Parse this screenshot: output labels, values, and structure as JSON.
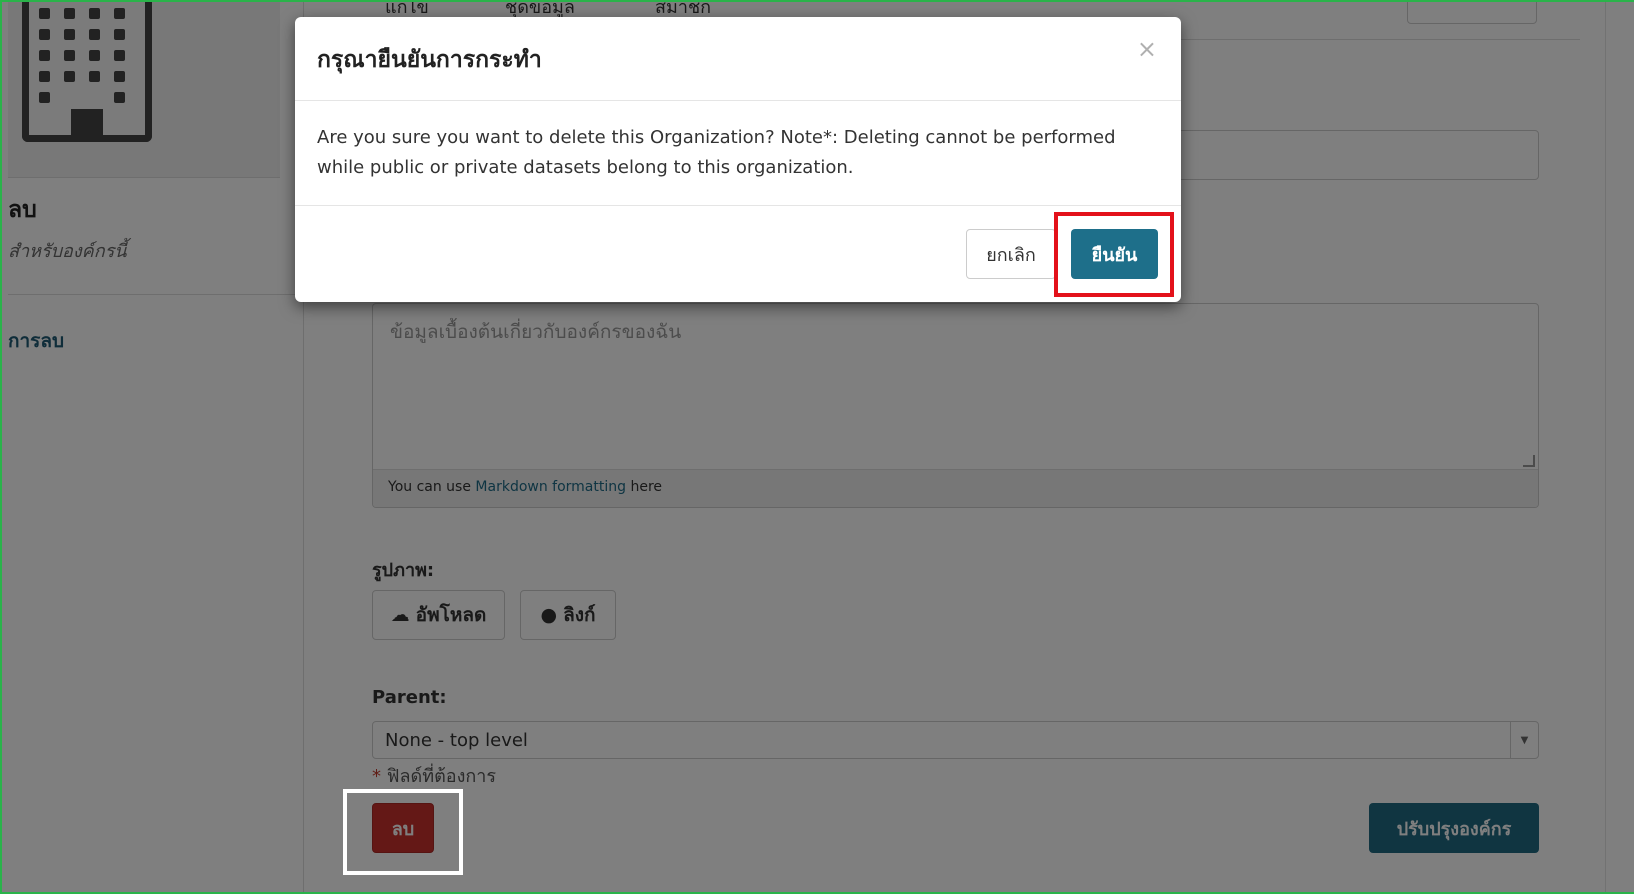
{
  "top_tabs": [
    "แก้ไข",
    "ชุดข้อมูล",
    "สมาชิก"
  ],
  "sidebar": {
    "title": "ลบ",
    "description": "สำหรับองค์กรนี้",
    "link_label": "การลบ"
  },
  "form": {
    "description_placeholder": "ข้อมูลเบื้องต้นเกี่ยวกับองค์กรของฉัน",
    "markdown_hint_prefix": "You can use ",
    "markdown_hint_link": "Markdown formatting",
    "markdown_hint_suffix": " here",
    "image_label": "รูปภาพ:",
    "upload_label": "อัพโหลด",
    "link_label": "ลิงก์",
    "parent_label": "Parent:",
    "parent_value": "None - top level",
    "required_star": "*",
    "required_text": "ฟิลด์ที่ต้องการ",
    "delete_label": "ลบ",
    "update_label": "ปรับปรุงองค์กร"
  },
  "modal": {
    "title": "กรุณายืนยันการกระทำ",
    "close_symbol": "×",
    "body": "Are you sure you want to delete this Organization? Note*: Deleting cannot be performed while public or private datasets belong to this organization.",
    "cancel_label": "ยกเลิก",
    "confirm_label": "ยืนยัน"
  },
  "colors": {
    "primary": "#1e6f8a",
    "danger": "#c9302c",
    "highlight_red": "#e3111a",
    "frame_green": "#2ab34a"
  }
}
